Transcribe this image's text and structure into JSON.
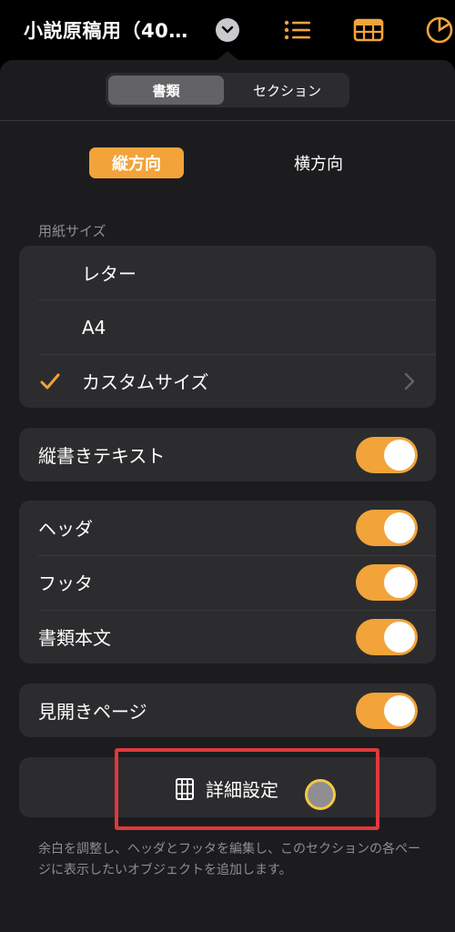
{
  "toolbar": {
    "document_title": "小説原稿用（40…",
    "icons": [
      "chevron-down-icon",
      "list-icon",
      "table-icon",
      "chart-icon"
    ]
  },
  "tabs": {
    "document": "書類",
    "section": "セクション",
    "selected": "書類"
  },
  "orientation": {
    "portrait": "縦方向",
    "landscape": "横方向",
    "selected": "縦方向"
  },
  "paper_size": {
    "section_label": "用紙サイズ",
    "options": [
      "レター",
      "A4",
      "カスタムサイズ"
    ],
    "selected": "カスタムサイズ"
  },
  "vertical_text": {
    "label": "縦書きテキスト",
    "on": true
  },
  "header_footer": {
    "header": {
      "label": "ヘッダ",
      "on": true
    },
    "footer": {
      "label": "フッタ",
      "on": true
    },
    "body": {
      "label": "書類本文",
      "on": true
    }
  },
  "facing_pages": {
    "label": "見開きページ",
    "on": true
  },
  "advanced": {
    "label": "詳細設定",
    "description": "余白を調整し、ヘッダとフッタを編集し、このセクションの各ページに表示したいオブジェクトを追加します。"
  },
  "colors": {
    "accent": "#f2a33a",
    "popover_bg": "#1c1c1e",
    "row_bg": "#2c2c2e",
    "highlight": "#e0383e"
  }
}
